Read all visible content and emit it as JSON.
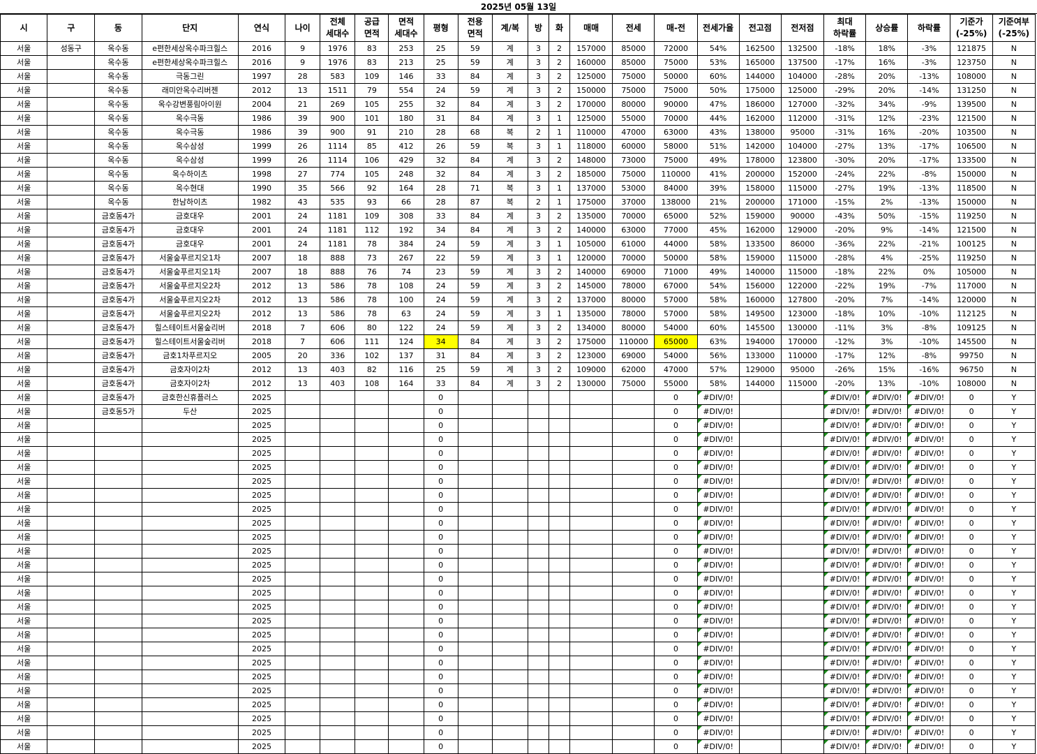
{
  "title": "2025년 05월 13일",
  "columns": [
    {
      "key": "si",
      "label": "시",
      "w": 67
    },
    {
      "key": "gu",
      "label": "구",
      "w": 68
    },
    {
      "key": "dong",
      "label": "동",
      "w": 67
    },
    {
      "key": "danji",
      "label": "단지",
      "w": 138
    },
    {
      "key": "year",
      "label": "연식",
      "w": 67
    },
    {
      "key": "age",
      "label": "나이",
      "w": 50
    },
    {
      "key": "total_units",
      "label": "전체\n세대수",
      "w": 50
    },
    {
      "key": "supply_area",
      "label": "공급\n면적",
      "w": 48
    },
    {
      "key": "area_units",
      "label": "면적\n세대수",
      "w": 50
    },
    {
      "key": "pyeong",
      "label": "평형",
      "w": 49
    },
    {
      "key": "excl_area",
      "label": "전용\n면적",
      "w": 49
    },
    {
      "key": "stair",
      "label": "계/복",
      "w": 51
    },
    {
      "key": "rooms",
      "label": "방",
      "w": 30
    },
    {
      "key": "baths",
      "label": "화",
      "w": 30
    },
    {
      "key": "sale",
      "label": "매매",
      "w": 61
    },
    {
      "key": "jeonse",
      "label": "전세",
      "w": 60
    },
    {
      "key": "gap",
      "label": "매-전",
      "w": 61
    },
    {
      "key": "ratio",
      "label": "전세가율",
      "w": 60
    },
    {
      "key": "high",
      "label": "전고점",
      "w": 60
    },
    {
      "key": "low",
      "label": "전저점",
      "w": 61
    },
    {
      "key": "max_drop",
      "label": "최대\n하락률",
      "w": 60
    },
    {
      "key": "rise",
      "label": "상승률",
      "w": 60
    },
    {
      "key": "fall",
      "label": "하락률",
      "w": 61
    },
    {
      "key": "base",
      "label": "기준가\n(-25%)",
      "w": 60
    },
    {
      "key": "base_flag",
      "label": "기준여부\n(-25%)",
      "w": 61
    }
  ],
  "rows": [
    [
      "서울",
      "성동구",
      "옥수동",
      "e편한세상옥수파크힐스",
      "2016",
      "9",
      "1976",
      "83",
      "253",
      "25",
      "59",
      "계",
      "3",
      "2",
      "157000",
      "85000",
      "72000",
      "54%",
      "162500",
      "132500",
      "-18%",
      "18%",
      "-3%",
      "121875",
      "N"
    ],
    [
      "서울",
      "",
      "옥수동",
      "e편한세상옥수파크힐스",
      "2016",
      "9",
      "1976",
      "83",
      "213",
      "25",
      "59",
      "계",
      "3",
      "2",
      "160000",
      "85000",
      "75000",
      "53%",
      "165000",
      "137500",
      "-17%",
      "16%",
      "-3%",
      "123750",
      "N"
    ],
    [
      "서울",
      "",
      "옥수동",
      "극동그린",
      "1997",
      "28",
      "583",
      "109",
      "146",
      "33",
      "84",
      "계",
      "3",
      "2",
      "125000",
      "75000",
      "50000",
      "60%",
      "144000",
      "104000",
      "-28%",
      "20%",
      "-13%",
      "108000",
      "N"
    ],
    [
      "서울",
      "",
      "옥수동",
      "래미안옥수리버젠",
      "2012",
      "13",
      "1511",
      "79",
      "554",
      "24",
      "59",
      "계",
      "3",
      "2",
      "150000",
      "75000",
      "75000",
      "50%",
      "175000",
      "125000",
      "-29%",
      "20%",
      "-14%",
      "131250",
      "N"
    ],
    [
      "서울",
      "",
      "옥수동",
      "옥수강변풍림아이원",
      "2004",
      "21",
      "269",
      "105",
      "255",
      "32",
      "84",
      "계",
      "3",
      "2",
      "170000",
      "80000",
      "90000",
      "47%",
      "186000",
      "127000",
      "-32%",
      "34%",
      "-9%",
      "139500",
      "N"
    ],
    [
      "서울",
      "",
      "옥수동",
      "옥수극동",
      "1986",
      "39",
      "900",
      "101",
      "180",
      "31",
      "84",
      "계",
      "3",
      "1",
      "125000",
      "55000",
      "70000",
      "44%",
      "162000",
      "112000",
      "-31%",
      "12%",
      "-23%",
      "121500",
      "N"
    ],
    [
      "서울",
      "",
      "옥수동",
      "옥수극동",
      "1986",
      "39",
      "900",
      "91",
      "210",
      "28",
      "68",
      "복",
      "2",
      "1",
      "110000",
      "47000",
      "63000",
      "43%",
      "138000",
      "95000",
      "-31%",
      "16%",
      "-20%",
      "103500",
      "N"
    ],
    [
      "서울",
      "",
      "옥수동",
      "옥수삼성",
      "1999",
      "26",
      "1114",
      "85",
      "412",
      "26",
      "59",
      "복",
      "3",
      "1",
      "118000",
      "60000",
      "58000",
      "51%",
      "142000",
      "104000",
      "-27%",
      "13%",
      "-17%",
      "106500",
      "N"
    ],
    [
      "서울",
      "",
      "옥수동",
      "옥수삼성",
      "1999",
      "26",
      "1114",
      "106",
      "429",
      "32",
      "84",
      "계",
      "3",
      "2",
      "148000",
      "73000",
      "75000",
      "49%",
      "178000",
      "123800",
      "-30%",
      "20%",
      "-17%",
      "133500",
      "N"
    ],
    [
      "서울",
      "",
      "옥수동",
      "옥수하이츠",
      "1998",
      "27",
      "774",
      "105",
      "248",
      "32",
      "84",
      "계",
      "3",
      "2",
      "185000",
      "75000",
      "110000",
      "41%",
      "200000",
      "152000",
      "-24%",
      "22%",
      "-8%",
      "150000",
      "N"
    ],
    [
      "서울",
      "",
      "옥수동",
      "옥수현대",
      "1990",
      "35",
      "566",
      "92",
      "164",
      "28",
      "71",
      "복",
      "3",
      "1",
      "137000",
      "53000",
      "84000",
      "39%",
      "158000",
      "115000",
      "-27%",
      "19%",
      "-13%",
      "118500",
      "N"
    ],
    [
      "서울",
      "",
      "옥수동",
      "한남하이츠",
      "1982",
      "43",
      "535",
      "93",
      "66",
      "28",
      "87",
      "복",
      "2",
      "1",
      "175000",
      "37000",
      "138000",
      "21%",
      "200000",
      "171000",
      "-15%",
      "2%",
      "-13%",
      "150000",
      "N"
    ],
    [
      "서울",
      "",
      "금호동4가",
      "금호대우",
      "2001",
      "24",
      "1181",
      "109",
      "308",
      "33",
      "84",
      "계",
      "3",
      "2",
      "135000",
      "70000",
      "65000",
      "52%",
      "159000",
      "90000",
      "-43%",
      "50%",
      "-15%",
      "119250",
      "N"
    ],
    [
      "서울",
      "",
      "금호동4가",
      "금호대우",
      "2001",
      "24",
      "1181",
      "112",
      "192",
      "34",
      "84",
      "계",
      "3",
      "2",
      "140000",
      "63000",
      "77000",
      "45%",
      "162000",
      "129000",
      "-20%",
      "9%",
      "-14%",
      "121500",
      "N"
    ],
    [
      "서울",
      "",
      "금호동4가",
      "금호대우",
      "2001",
      "24",
      "1181",
      "78",
      "384",
      "24",
      "59",
      "계",
      "3",
      "1",
      "105000",
      "61000",
      "44000",
      "58%",
      "133500",
      "86000",
      "-36%",
      "22%",
      "-21%",
      "100125",
      "N"
    ],
    [
      "서울",
      "",
      "금호동4가",
      "서울숲푸르지오1차",
      "2007",
      "18",
      "888",
      "73",
      "267",
      "22",
      "59",
      "계",
      "3",
      "1",
      "120000",
      "70000",
      "50000",
      "58%",
      "159000",
      "115000",
      "-28%",
      "4%",
      "-25%",
      "119250",
      "N"
    ],
    [
      "서울",
      "",
      "금호동4가",
      "서울숲푸르지오1차",
      "2007",
      "18",
      "888",
      "76",
      "74",
      "23",
      "59",
      "계",
      "3",
      "2",
      "140000",
      "69000",
      "71000",
      "49%",
      "140000",
      "115000",
      "-18%",
      "22%",
      "0%",
      "105000",
      "N"
    ],
    [
      "서울",
      "",
      "금호동4가",
      "서울숲푸르지오2차",
      "2012",
      "13",
      "586",
      "78",
      "108",
      "24",
      "59",
      "계",
      "3",
      "2",
      "145000",
      "78000",
      "67000",
      "54%",
      "156000",
      "122000",
      "-22%",
      "19%",
      "-7%",
      "117000",
      "N"
    ],
    [
      "서울",
      "",
      "금호동4가",
      "서울숲푸르지오2차",
      "2012",
      "13",
      "586",
      "78",
      "100",
      "24",
      "59",
      "계",
      "3",
      "2",
      "137000",
      "80000",
      "57000",
      "58%",
      "160000",
      "127800",
      "-20%",
      "7%",
      "-14%",
      "120000",
      "N"
    ],
    [
      "서울",
      "",
      "금호동4가",
      "서울숲푸르지오2차",
      "2012",
      "13",
      "586",
      "78",
      "63",
      "24",
      "59",
      "계",
      "3",
      "1",
      "135000",
      "78000",
      "57000",
      "58%",
      "149500",
      "123000",
      "-18%",
      "10%",
      "-10%",
      "112125",
      "N"
    ],
    [
      "서울",
      "",
      "금호동4가",
      "힐스테이트서울숲리버",
      "2018",
      "7",
      "606",
      "80",
      "122",
      "24",
      "59",
      "계",
      "3",
      "2",
      "134000",
      "80000",
      "54000",
      "60%",
      "145500",
      "130000",
      "-11%",
      "3%",
      "-8%",
      "109125",
      "N"
    ],
    [
      "서울",
      "",
      "금호동4가",
      "힐스테이트서울숲리버",
      "2018",
      "7",
      "606",
      "111",
      "124",
      "34",
      "84",
      "계",
      "3",
      "2",
      "175000",
      "110000",
      "65000",
      "63%",
      "194000",
      "170000",
      "-12%",
      "3%",
      "-10%",
      "145500",
      "N"
    ],
    [
      "서울",
      "",
      "금호동4가",
      "금호1차푸르지오",
      "2005",
      "20",
      "336",
      "102",
      "137",
      "31",
      "84",
      "계",
      "3",
      "2",
      "123000",
      "69000",
      "54000",
      "56%",
      "133000",
      "110000",
      "-17%",
      "12%",
      "-8%",
      "99750",
      "N"
    ],
    [
      "서울",
      "",
      "금호동4가",
      "금호자이2차",
      "2012",
      "13",
      "403",
      "82",
      "116",
      "25",
      "59",
      "계",
      "3",
      "2",
      "109000",
      "62000",
      "47000",
      "57%",
      "129000",
      "95000",
      "-26%",
      "15%",
      "-16%",
      "96750",
      "N"
    ],
    [
      "서울",
      "",
      "금호동4가",
      "금호자이2차",
      "2012",
      "13",
      "403",
      "108",
      "164",
      "33",
      "84",
      "계",
      "3",
      "2",
      "130000",
      "75000",
      "55000",
      "58%",
      "144000",
      "115000",
      "-20%",
      "13%",
      "-10%",
      "108000",
      "N"
    ],
    [
      "서울",
      "",
      "금호동4가",
      "금호한신휴플러스",
      "2025",
      "",
      "",
      "",
      "",
      "0",
      "",
      "",
      "",
      "",
      "",
      "",
      "0",
      "#DIV/0!",
      "",
      "",
      "#DIV/0!",
      "#DIV/0!",
      "#DIV/0!",
      "0",
      "Y"
    ],
    [
      "서울",
      "",
      "금호동5가",
      "두산",
      "2025",
      "",
      "",
      "",
      "",
      "0",
      "",
      "",
      "",
      "",
      "",
      "",
      "0",
      "#DIV/0!",
      "",
      "",
      "#DIV/0!",
      "#DIV/0!",
      "#DIV/0!",
      "0",
      "Y"
    ],
    [
      "서울",
      "",
      "",
      "",
      "2025",
      "",
      "",
      "",
      "",
      "0",
      "",
      "",
      "",
      "",
      "",
      "",
      "0",
      "#DIV/0!",
      "",
      "",
      "#DIV/0!",
      "#DIV/0!",
      "#DIV/0!",
      "0",
      "Y"
    ],
    [
      "서울",
      "",
      "",
      "",
      "2025",
      "",
      "",
      "",
      "",
      "0",
      "",
      "",
      "",
      "",
      "",
      "",
      "0",
      "#DIV/0!",
      "",
      "",
      "#DIV/0!",
      "#DIV/0!",
      "#DIV/0!",
      "0",
      "Y"
    ],
    [
      "서울",
      "",
      "",
      "",
      "2025",
      "",
      "",
      "",
      "",
      "0",
      "",
      "",
      "",
      "",
      "",
      "",
      "0",
      "#DIV/0!",
      "",
      "",
      "#DIV/0!",
      "#DIV/0!",
      "#DIV/0!",
      "0",
      "Y"
    ],
    [
      "서울",
      "",
      "",
      "",
      "2025",
      "",
      "",
      "",
      "",
      "0",
      "",
      "",
      "",
      "",
      "",
      "",
      "0",
      "#DIV/0!",
      "",
      "",
      "#DIV/0!",
      "#DIV/0!",
      "#DIV/0!",
      "0",
      "Y"
    ],
    [
      "서울",
      "",
      "",
      "",
      "2025",
      "",
      "",
      "",
      "",
      "0",
      "",
      "",
      "",
      "",
      "",
      "",
      "0",
      "#DIV/0!",
      "",
      "",
      "#DIV/0!",
      "#DIV/0!",
      "#DIV/0!",
      "0",
      "Y"
    ],
    [
      "서울",
      "",
      "",
      "",
      "2025",
      "",
      "",
      "",
      "",
      "0",
      "",
      "",
      "",
      "",
      "",
      "",
      "0",
      "#DIV/0!",
      "",
      "",
      "#DIV/0!",
      "#DIV/0!",
      "#DIV/0!",
      "0",
      "Y"
    ],
    [
      "서울",
      "",
      "",
      "",
      "2025",
      "",
      "",
      "",
      "",
      "0",
      "",
      "",
      "",
      "",
      "",
      "",
      "0",
      "#DIV/0!",
      "",
      "",
      "#DIV/0!",
      "#DIV/0!",
      "#DIV/0!",
      "0",
      "Y"
    ],
    [
      "서울",
      "",
      "",
      "",
      "2025",
      "",
      "",
      "",
      "",
      "0",
      "",
      "",
      "",
      "",
      "",
      "",
      "0",
      "#DIV/0!",
      "",
      "",
      "#DIV/0!",
      "#DIV/0!",
      "#DIV/0!",
      "0",
      "Y"
    ],
    [
      "서울",
      "",
      "",
      "",
      "2025",
      "",
      "",
      "",
      "",
      "0",
      "",
      "",
      "",
      "",
      "",
      "",
      "0",
      "#DIV/0!",
      "",
      "",
      "#DIV/0!",
      "#DIV/0!",
      "#DIV/0!",
      "0",
      "Y"
    ],
    [
      "서울",
      "",
      "",
      "",
      "2025",
      "",
      "",
      "",
      "",
      "0",
      "",
      "",
      "",
      "",
      "",
      "",
      "0",
      "#DIV/0!",
      "",
      "",
      "#DIV/0!",
      "#DIV/0!",
      "#DIV/0!",
      "0",
      "Y"
    ],
    [
      "서울",
      "",
      "",
      "",
      "2025",
      "",
      "",
      "",
      "",
      "0",
      "",
      "",
      "",
      "",
      "",
      "",
      "0",
      "#DIV/0!",
      "",
      "",
      "#DIV/0!",
      "#DIV/0!",
      "#DIV/0!",
      "0",
      "Y"
    ],
    [
      "서울",
      "",
      "",
      "",
      "2025",
      "",
      "",
      "",
      "",
      "0",
      "",
      "",
      "",
      "",
      "",
      "",
      "0",
      "#DIV/0!",
      "",
      "",
      "#DIV/0!",
      "#DIV/0!",
      "#DIV/0!",
      "0",
      "Y"
    ],
    [
      "서울",
      "",
      "",
      "",
      "2025",
      "",
      "",
      "",
      "",
      "0",
      "",
      "",
      "",
      "",
      "",
      "",
      "0",
      "#DIV/0!",
      "",
      "",
      "#DIV/0!",
      "#DIV/0!",
      "#DIV/0!",
      "0",
      "Y"
    ],
    [
      "서울",
      "",
      "",
      "",
      "2025",
      "",
      "",
      "",
      "",
      "0",
      "",
      "",
      "",
      "",
      "",
      "",
      "0",
      "#DIV/0!",
      "",
      "",
      "#DIV/0!",
      "#DIV/0!",
      "#DIV/0!",
      "0",
      "Y"
    ],
    [
      "서울",
      "",
      "",
      "",
      "2025",
      "",
      "",
      "",
      "",
      "0",
      "",
      "",
      "",
      "",
      "",
      "",
      "0",
      "#DIV/0!",
      "",
      "",
      "#DIV/0!",
      "#DIV/0!",
      "#DIV/0!",
      "0",
      "Y"
    ],
    [
      "서울",
      "",
      "",
      "",
      "2025",
      "",
      "",
      "",
      "",
      "0",
      "",
      "",
      "",
      "",
      "",
      "",
      "0",
      "#DIV/0!",
      "",
      "",
      "#DIV/0!",
      "#DIV/0!",
      "#DIV/0!",
      "0",
      "Y"
    ],
    [
      "서울",
      "",
      "",
      "",
      "2025",
      "",
      "",
      "",
      "",
      "0",
      "",
      "",
      "",
      "",
      "",
      "",
      "0",
      "#DIV/0!",
      "",
      "",
      "#DIV/0!",
      "#DIV/0!",
      "#DIV/0!",
      "0",
      "Y"
    ],
    [
      "서울",
      "",
      "",
      "",
      "2025",
      "",
      "",
      "",
      "",
      "0",
      "",
      "",
      "",
      "",
      "",
      "",
      "0",
      "#DIV/0!",
      "",
      "",
      "#DIV/0!",
      "#DIV/0!",
      "#DIV/0!",
      "0",
      "Y"
    ],
    [
      "서울",
      "",
      "",
      "",
      "2025",
      "",
      "",
      "",
      "",
      "0",
      "",
      "",
      "",
      "",
      "",
      "",
      "0",
      "#DIV/0!",
      "",
      "",
      "#DIV/0!",
      "#DIV/0!",
      "#DIV/0!",
      "0",
      "Y"
    ],
    [
      "서울",
      "",
      "",
      "",
      "2025",
      "",
      "",
      "",
      "",
      "0",
      "",
      "",
      "",
      "",
      "",
      "",
      "0",
      "#DIV/0!",
      "",
      "",
      "#DIV/0!",
      "#DIV/0!",
      "#DIV/0!",
      "0",
      "Y"
    ],
    [
      "서울",
      "",
      "",
      "",
      "2025",
      "",
      "",
      "",
      "",
      "0",
      "",
      "",
      "",
      "",
      "",
      "",
      "0",
      "#DIV/0!",
      "",
      "",
      "#DIV/0!",
      "#DIV/0!",
      "#DIV/0!",
      "0",
      "Y"
    ],
    [
      "서울",
      "",
      "",
      "",
      "2025",
      "",
      "",
      "",
      "",
      "0",
      "",
      "",
      "",
      "",
      "",
      "",
      "0",
      "#DIV/0!",
      "",
      "",
      "#DIV/0!",
      "#DIV/0!",
      "#DIV/0!",
      "0",
      "Y"
    ],
    [
      "서울",
      "",
      "",
      "",
      "2025",
      "",
      "",
      "",
      "",
      "0",
      "",
      "",
      "",
      "",
      "",
      "",
      "0",
      "#DIV/0!",
      "",
      "",
      "#DIV/0!",
      "#DIV/0!",
      "#DIV/0!",
      "0",
      "Y"
    ],
    [
      "서울",
      "",
      "",
      "",
      "2025",
      "",
      "",
      "",
      "",
      "0",
      "",
      "",
      "",
      "",
      "",
      "",
      "0",
      "#DIV/0!",
      "",
      "",
      "#DIV/0!",
      "#DIV/0!",
      "#DIV/0!",
      "0",
      "Y"
    ]
  ],
  "highlighted_cells": [
    {
      "row": 21,
      "col": 9
    },
    {
      "row": 21,
      "col": 16
    }
  ],
  "highlight_color": "#ffff00",
  "error_marker_color": "#1e8f1e",
  "error_marker_cols": [
    17,
    20,
    21,
    22
  ]
}
